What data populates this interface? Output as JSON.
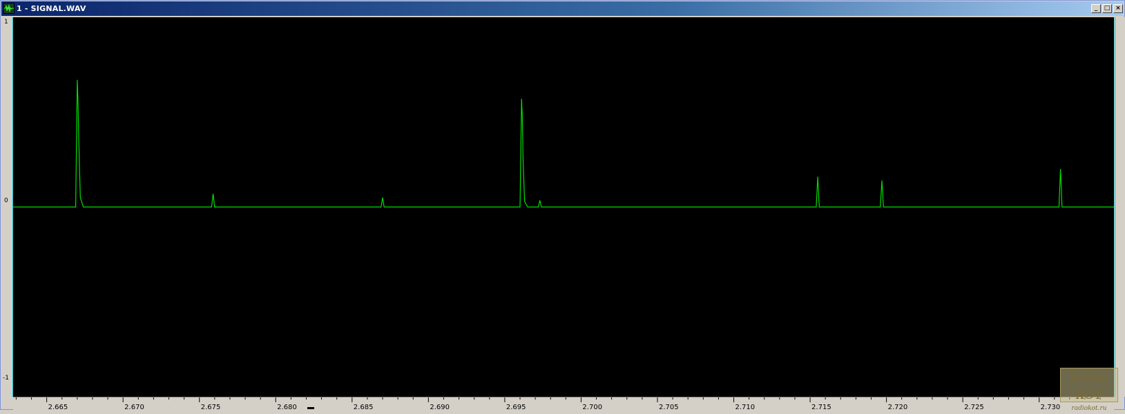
{
  "window": {
    "title": "1 - SIGNAL.WAV",
    "min_label": "_",
    "max_label": "□",
    "close_label": "×"
  },
  "y_axis": {
    "top_label": "1",
    "mid_label": "0",
    "bottom_label": "-1"
  },
  "x_axis": {
    "tick_labels": [
      "2.665",
      "2.670",
      "2.675",
      "2.680",
      "2.685",
      "2.690",
      "2.695",
      "2.700",
      "2.705",
      "2.710",
      "2.715",
      "2.720",
      "2.725",
      "2.730"
    ]
  },
  "watermark": {
    "main": "Радио КОТ",
    "sub": "radiokot.ru"
  },
  "chart_data": {
    "type": "line",
    "ylim": [
      -1,
      1
    ],
    "xlim": [
      2.6628,
      2.7349
    ],
    "series": [
      {
        "values_desc": "",
        "x": [
          2.6628,
          2.6669,
          2.667,
          2.66705,
          2.6671,
          2.6672,
          2.6674,
          2.6758,
          2.6759,
          2.676,
          2.6869,
          2.687,
          2.6871,
          2.696,
          2.6961,
          2.69615,
          2.6962,
          2.6963,
          2.6965,
          2.6972,
          2.6973,
          2.6974,
          2.7154,
          2.7155,
          2.7156,
          2.7196,
          2.7197,
          2.7198,
          2.7313,
          2.7314,
          2.7315,
          2.7349
        ],
        "y": [
          0,
          0,
          0.67,
          0.55,
          0.35,
          0.05,
          0,
          0,
          0.07,
          0,
          0,
          0.05,
          0,
          0,
          0.57,
          0.48,
          0.25,
          0.03,
          0,
          0,
          0.035,
          0,
          0,
          0.16,
          0,
          0,
          0.14,
          0,
          0,
          0.2,
          0,
          0
        ]
      }
    ],
    "line_color": "#00e000",
    "background": "#000000",
    "grid": false
  }
}
